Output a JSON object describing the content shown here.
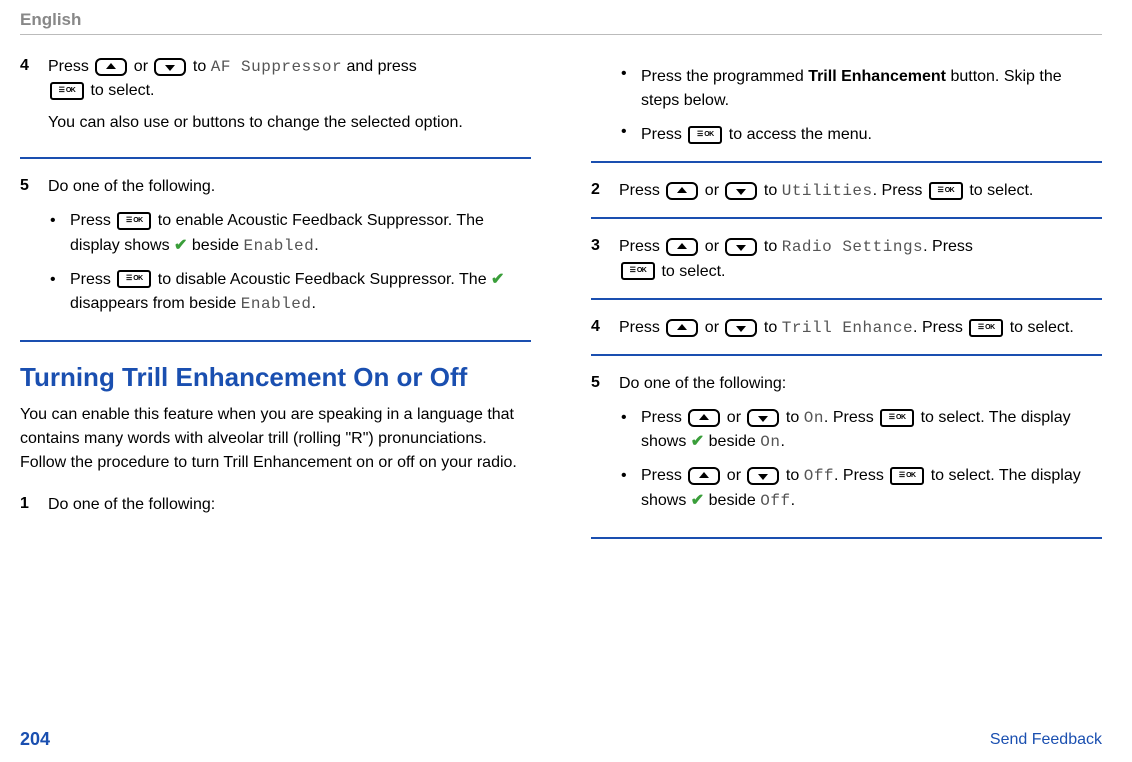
{
  "header": "English",
  "col1": {
    "step4_num": "4",
    "step4_line1a": "Press ",
    "step4_line1b": " or ",
    "step4_line1c": " to ",
    "step4_af": "AF Suppressor",
    "step4_line1d": " and press ",
    "step4_line2": " to select.",
    "step4_note": "You can also use or buttons to change the selected option.",
    "step5_num": "5",
    "step5_text": "Do one of the following.",
    "step5_b1a": "Press ",
    "step5_b1b": " to enable Acoustic Feedback Suppressor. The display shows ",
    "step5_b1c": " beside ",
    "step5_enabled1": "Enabled",
    "step5_b1d": ".",
    "step5_b2a": "Press ",
    "step5_b2b": " to disable Acoustic Feedback Suppressor. The ",
    "step5_b2c": " disappears from beside ",
    "step5_enabled2": "Enabled",
    "step5_b2d": ".",
    "section_title": "Turning Trill Enhancement On or Off",
    "section_intro": "You can enable this feature when you are speaking in a language that contains many words with alveolar trill (rolling \"R\") pronunciations. Follow the procedure to turn Trill Enhancement on or off on your radio.",
    "step1_num": "1",
    "step1_text": "Do one of the following:"
  },
  "col2": {
    "b1a": "Press the programmed ",
    "b1_bold": "Trill Enhancement",
    "b1b": " button. Skip the steps below.",
    "b2a": "Press ",
    "b2b": " to access the menu.",
    "step2_num": "2",
    "step2a": "Press ",
    "step2b": " or ",
    "step2c": " to ",
    "step2_util": "Utilities",
    "step2d": ". Press ",
    "step2e": " to select.",
    "step3_num": "3",
    "step3a": "Press ",
    "step3b": " or ",
    "step3c": " to ",
    "step3_rs": "Radio Settings",
    "step3d": ". Press ",
    "step3e": " to select.",
    "step4_num": "4",
    "step4a": "Press ",
    "step4b": " or ",
    "step4c": " to ",
    "step4_te": "Trill Enhance",
    "step4d": ". Press ",
    "step4e": " to select.",
    "step5_num": "5",
    "step5_text": "Do one of the following:",
    "s5b1a": "Press ",
    "s5b1b": " or ",
    "s5b1c": " to ",
    "s5b1_on": "On",
    "s5b1d": ". Press ",
    "s5b1e": " to select. The display shows ",
    "s5b1f": " beside ",
    "s5b1_on2": "On",
    "s5b1g": ".",
    "s5b2a": "Press ",
    "s5b2b": " or ",
    "s5b2c": " to ",
    "s5b2_off": "Off",
    "s5b2d": ". Press ",
    "s5b2e": " to select. The display shows ",
    "s5b2f": " beside ",
    "s5b2_off2": "Off",
    "s5b2g": "."
  },
  "footer": {
    "page": "204",
    "feedback": "Send Feedback"
  }
}
